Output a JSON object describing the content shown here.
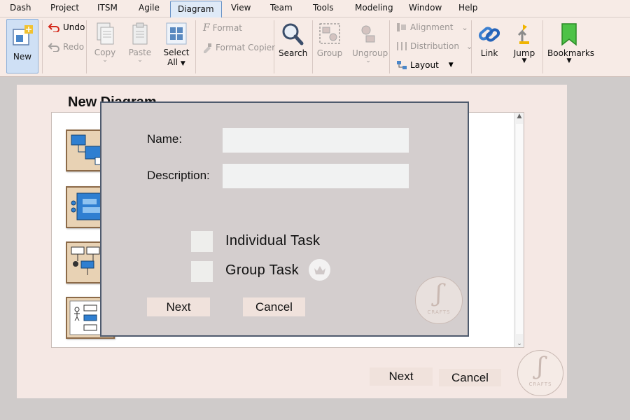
{
  "menu": {
    "items": [
      "Dash",
      "Project",
      "ITSM",
      "Agile",
      "Diagram",
      "View",
      "Team",
      "Tools",
      "Modeling",
      "Window",
      "Help"
    ],
    "active": "Diagram"
  },
  "toolbar": {
    "new": "New",
    "undo": "Undo",
    "redo": "Redo",
    "copy": "Copy",
    "paste": "Paste",
    "select_all_1": "Select",
    "select_all_2": "All",
    "format": "Format",
    "format_copier": "Format Copier",
    "search": "Search",
    "group": "Group",
    "ungroup": "Ungroup",
    "alignment": "Alignment",
    "distribution": "Distribution",
    "layout": "Layout",
    "link": "Link",
    "jump": "Jump",
    "bookmarks": "Bookmarks"
  },
  "panel": {
    "title": "New Diagram",
    "next": "Next",
    "cancel": "Cancel"
  },
  "dialog": {
    "name_label": "Name:",
    "name_value": "",
    "description_label": "Description:",
    "description_value": "",
    "options": [
      {
        "label": "Individual Task",
        "checked": false
      },
      {
        "label": "Group Task",
        "checked": false
      }
    ],
    "next": "Next",
    "cancel": "Cancel"
  },
  "logo": {
    "brand": "CRAFTS"
  },
  "colors": {
    "background": "#cfcbca",
    "panel": "#f5e8e4",
    "dialog": "#d4cece",
    "dialog_border": "#4e5a6d",
    "button": "#f0e2dc",
    "active_tab": "#dfeaf7"
  }
}
